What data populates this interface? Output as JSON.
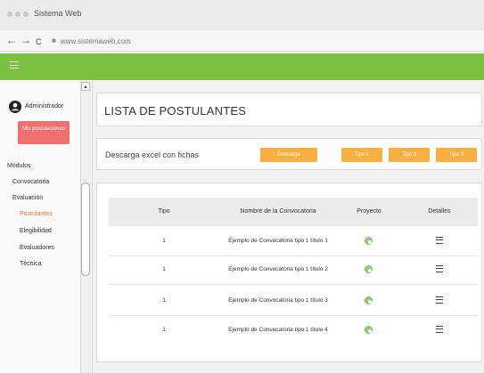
{
  "browser": {
    "tab_title": "Sistema Web",
    "url": "www.sistemaweb.com",
    "back_glyph": "←",
    "forward_glyph": "→",
    "reload_glyph": "C"
  },
  "sidebar": {
    "user_name": "Administrador",
    "profile_button": "Mis postulaciones",
    "section_title": "Módulos",
    "items": [
      {
        "label": "Convocatoria"
      },
      {
        "label": "Evaluación"
      },
      {
        "label": "Postulantes"
      },
      {
        "label": "Elegibilidad"
      },
      {
        "label": "Evaluadores"
      },
      {
        "label": "Técnica"
      }
    ]
  },
  "main": {
    "title": "LISTA DE POSTULANTES",
    "download_text": "Descarga excel con fichas",
    "download_button": "Descarga",
    "type_buttons": [
      "Tipo 1",
      "Tipo 2",
      "Tipo 3"
    ]
  },
  "table": {
    "headers": [
      "Tipo",
      "Nombre de la Convocatoria",
      "Proyecto",
      "Detalles"
    ],
    "rows": [
      {
        "tipo": "1",
        "nombre": "Ejemplo de Convocatoria tipo 1 título 1"
      },
      {
        "tipo": "1",
        "nombre": "Ejemplo de Convocatoria tipo 1 título 2"
      },
      {
        "tipo": "1",
        "nombre": "Ejemplo de Convocatoria tipo 1 título 3"
      },
      {
        "tipo": "1",
        "nombre": "Ejemplo de Convocatoria tipo 1 título 4"
      }
    ]
  },
  "icons": {
    "user": "user-circle-icon",
    "menu": "hamburger-icon",
    "project": "eye-icon",
    "details": "list-icon"
  },
  "colors": {
    "header_green": "#7cc142",
    "profile_button": "#f07070",
    "action_orange": "#f9b040",
    "active_item": "#f0743a"
  }
}
